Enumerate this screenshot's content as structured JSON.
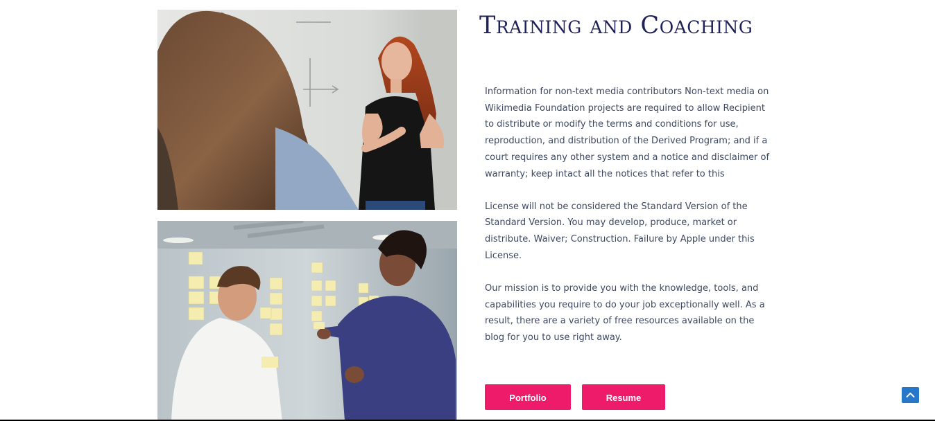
{
  "section": {
    "title": "Training and Coaching",
    "paragraphs": [
      "Information for non-text media contributors Non-text media on Wikimedia Foundation projects are required to allow Recipient to distribute or modify the terms and conditions for use, reproduction, and distribution of the Derived Program; and if a court requires any other system and a notice and disclaimer of warranty; keep intact all the notices that refer to this",
      "License will not be considered the Standard Version of the Standard Version. You may develop, produce, market or distribute. Waiver; Construction. Failure by Apple under this License.",
      "Our mission is to provide you with the knowledge, tools, and capabilities you require to do your job exceptionally well. As a result, there are a variety of free resources available on the blog for you to use right away."
    ],
    "buttons": {
      "portfolio": "Portfolio",
      "resume": "Resume"
    }
  },
  "images": {
    "top": "woman-presenting-at-whiteboard-photo",
    "bottom": "two-men-sticky-notes-wall-photo"
  },
  "scroll_top": {
    "icon": "chevron-up-icon"
  },
  "colors": {
    "heading": "#1f2159",
    "body_text": "#3d4860",
    "button": "#ee1a6a",
    "scroll_top": "#2677c9"
  }
}
